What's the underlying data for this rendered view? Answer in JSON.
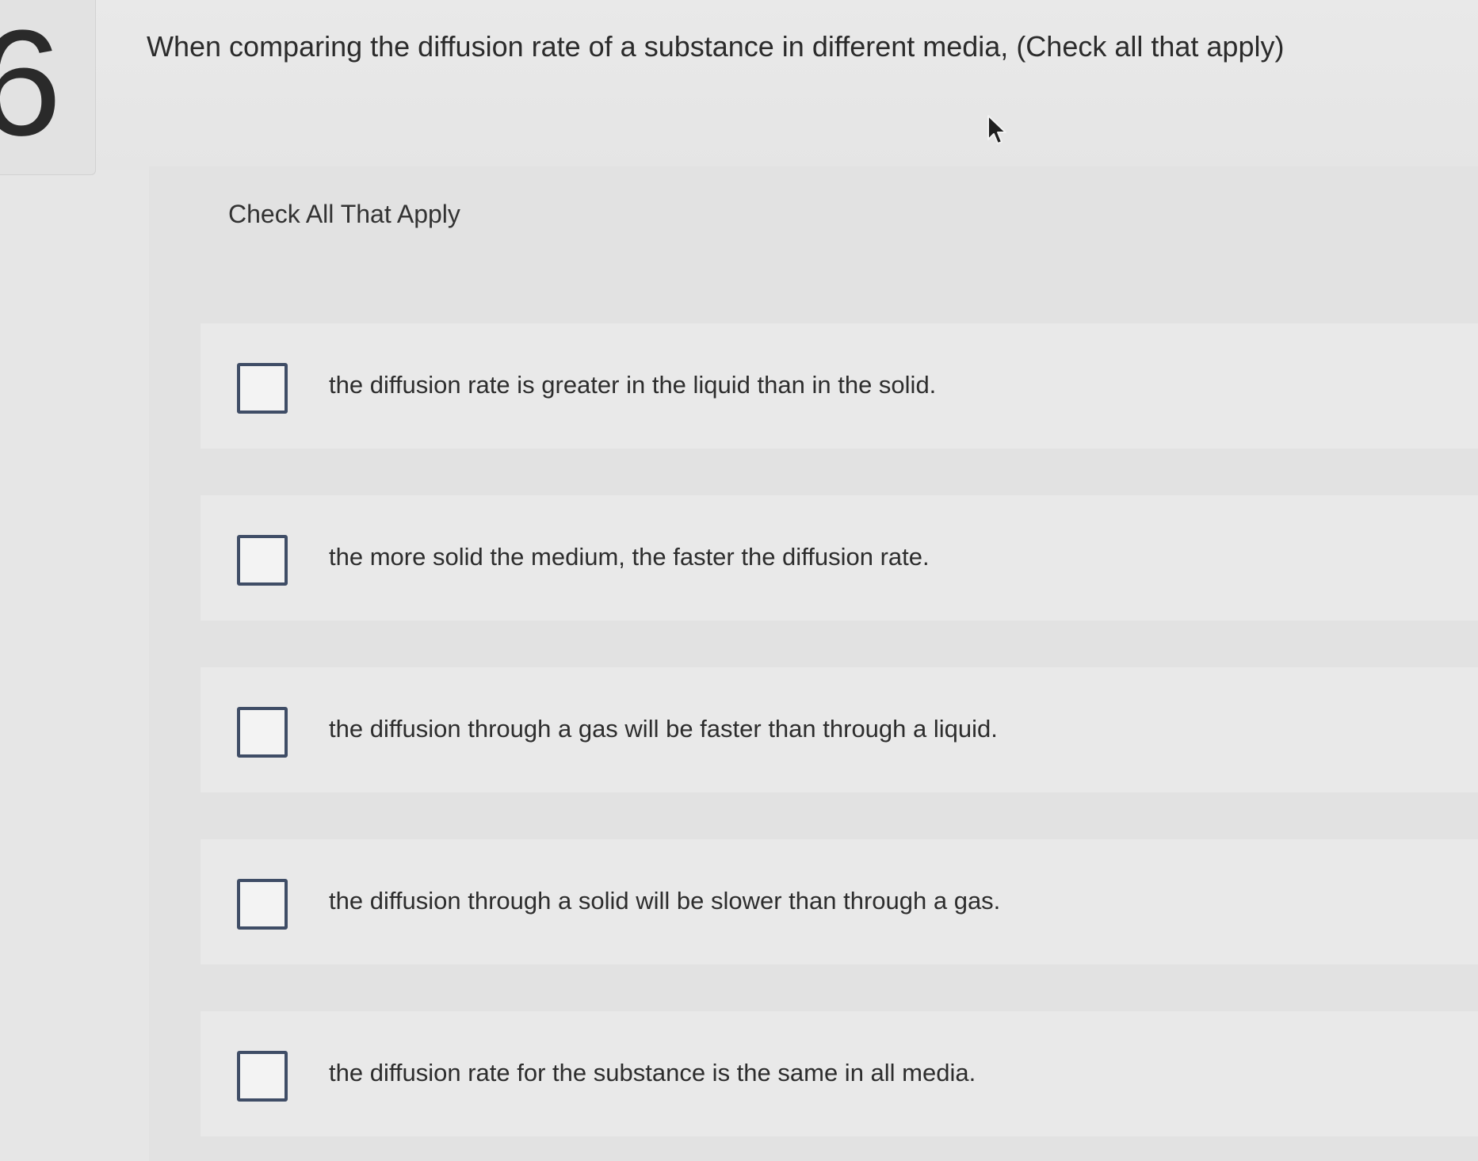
{
  "question_number": "6",
  "question": "When comparing the diffusion rate of a substance in different media, (Check all that apply)",
  "instructions": "Check All That Apply",
  "options": [
    {
      "label": "the diffusion rate is greater in the liquid than in the solid.",
      "checked": false
    },
    {
      "label": "the more solid the medium, the faster the diffusion rate.",
      "checked": false
    },
    {
      "label": "the diffusion through a gas will be faster than through a liquid.",
      "checked": false
    },
    {
      "label": "the diffusion through a solid will be slower than through a gas.",
      "checked": false
    },
    {
      "label": "the diffusion rate for the substance is the same in all media.",
      "checked": false
    }
  ],
  "colors": {
    "checkbox_border": "#3f4d66",
    "text": "#2b2b2b",
    "background": "#e6e6e6"
  },
  "icons": [
    "mouse-cursor-icon"
  ]
}
